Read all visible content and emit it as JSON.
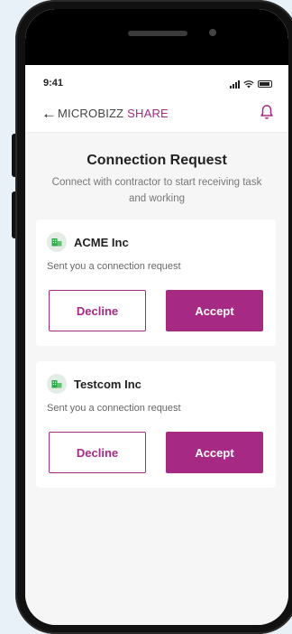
{
  "status_bar": {
    "time": "9:41"
  },
  "header": {
    "brand_part1": "MICROBIZZ",
    "brand_part2": "SHARE"
  },
  "page": {
    "title": "Connection Request",
    "subtitle": "Connect with contractor to start receiving task and working"
  },
  "requests": [
    {
      "company": "ACME Inc",
      "message": "Sent you a connection request",
      "decline_label": "Decline",
      "accept_label": "Accept"
    },
    {
      "company": "Testcom Inc",
      "message": "Sent you a connection request",
      "decline_label": "Decline",
      "accept_label": "Accept"
    }
  ],
  "colors": {
    "accent": "#a62a84",
    "company_icon": "#2faa4a"
  },
  "icons": {
    "back": "arrow-left-icon",
    "bell": "bell-icon",
    "company": "building-icon"
  }
}
